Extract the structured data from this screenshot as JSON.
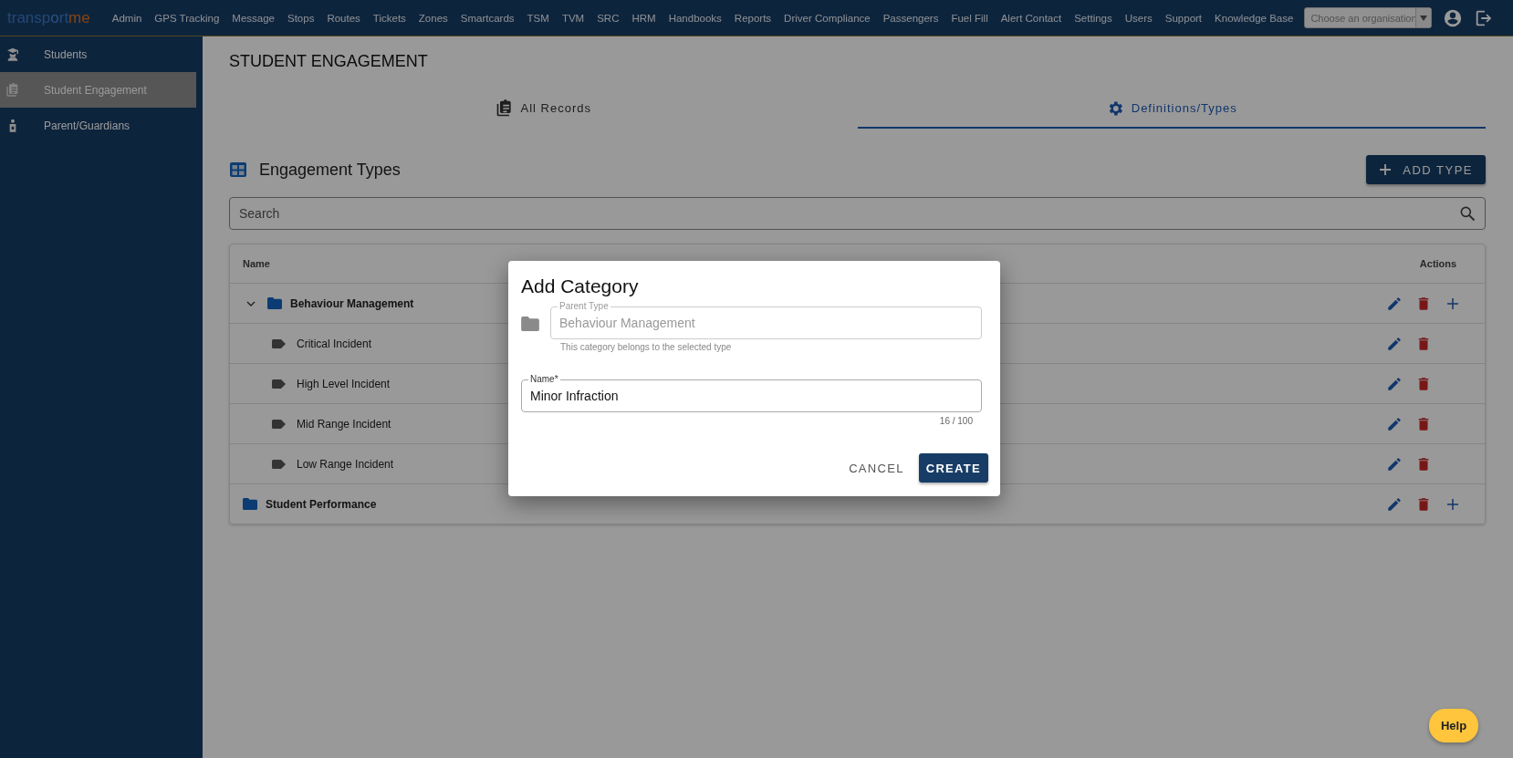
{
  "topbar": {
    "logo": {
      "part_1": "transp",
      "part_2": "o",
      "part_3": "rt",
      "part_4": "me"
    },
    "menu": [
      "Admin",
      "GPS Tracking",
      "Message",
      "Stops",
      "Routes",
      "Tickets",
      "Zones",
      "Smartcards",
      "TSM",
      "TVM",
      "SRC",
      "HRM",
      "Handbooks",
      "Reports",
      "Driver Compliance",
      "Passengers",
      "Fuel Fill",
      "Alert Contact",
      "Settings",
      "Users",
      "Support",
      "Knowledge Base"
    ],
    "organisation_select": {
      "placeholder": "Choose an organisation"
    }
  },
  "sidebar": {
    "items": [
      {
        "label": "Students",
        "selected": false
      },
      {
        "label": "Student Engagement",
        "selected": true
      },
      {
        "label": "Parent/Guardians",
        "selected": false
      }
    ]
  },
  "page_title": "STUDENT ENGAGEMENT",
  "tabs": [
    {
      "label": "All Records",
      "selected": false
    },
    {
      "label": "Definitions/Types",
      "selected": true
    }
  ],
  "section": {
    "title": "Engagement Types",
    "add_button": "ADD TYPE",
    "search": {
      "placeholder": "Search"
    }
  },
  "table": {
    "columns": [
      "Name",
      "Actions"
    ],
    "rows": [
      {
        "kind": "group",
        "name": "Behaviour Management",
        "expanded": true,
        "children": [
          {
            "kind": "item",
            "name": "Critical Incident"
          },
          {
            "kind": "item",
            "name": "High Level Incident"
          },
          {
            "kind": "item",
            "name": "Mid Range Incident"
          },
          {
            "kind": "item",
            "name": "Low Range Incident"
          }
        ]
      },
      {
        "kind": "group",
        "name": "Student Performance",
        "expanded": false
      }
    ]
  },
  "dialog": {
    "title": "Add Category",
    "parent_field": {
      "label": "Parent Type",
      "value": "Behaviour Management",
      "hint": "This category belongs to the selected type",
      "disabled": true
    },
    "name_field": {
      "label": "Name*",
      "value": "Minor Infraction",
      "counter": "16 / 100"
    },
    "buttons": [
      {
        "label": "CANCEL",
        "kind": "text"
      },
      {
        "label": "CREATE",
        "kind": "primary"
      }
    ]
  },
  "help_button": "Help"
}
